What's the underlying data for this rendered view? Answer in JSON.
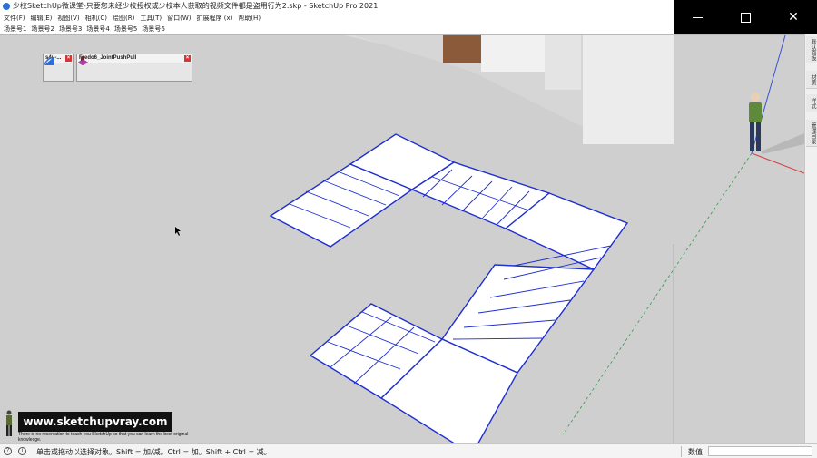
{
  "window": {
    "title": "少校SketchUp微课堂-只要您未经少校授权或少校本人获取的视频文件都是盗用行为2.skp - SketchUp Pro 2021",
    "controls": {
      "minimize": "minimize",
      "maximize": "maximize",
      "close": "✕"
    }
  },
  "menu": [
    "文件(F)",
    "编辑(E)",
    "视图(V)",
    "相机(C)",
    "绘图(R)",
    "工具(T)",
    "窗口(W)",
    "扩展程序 (x)",
    "帮助(H)"
  ],
  "scenes": [
    "场景号1",
    "场景号2",
    "场景号3",
    "场景号4",
    "场景号5",
    "场景号6"
  ],
  "active_scene": "场景号2",
  "toolbars": {
    "s4u": {
      "title": "s4u-..."
    },
    "fredo": {
      "title": "Fredo6_JointPushPull"
    }
  },
  "right_panel": [
    "默认面板",
    "材质",
    "样式",
    "管理目录"
  ],
  "brand": {
    "url": "www.sketchupvray.com",
    "subtitle": "There is no reservation to teach you SketchUp so that you can learn the best original knowledge."
  },
  "status": {
    "text": "单击或拖动以选择对象。Shift = 加/减。Ctrl = 加。Shift + Ctrl = 减。",
    "measure_label": "数值",
    "measure_value": ""
  },
  "colors": {
    "edge_selected": "#1f2fd0",
    "ground": "#cfcfcf",
    "sky": "#ffffff",
    "axis_red": "#d04040",
    "axis_green": "#2e9a4a",
    "axis_blue": "#3a52d6"
  }
}
